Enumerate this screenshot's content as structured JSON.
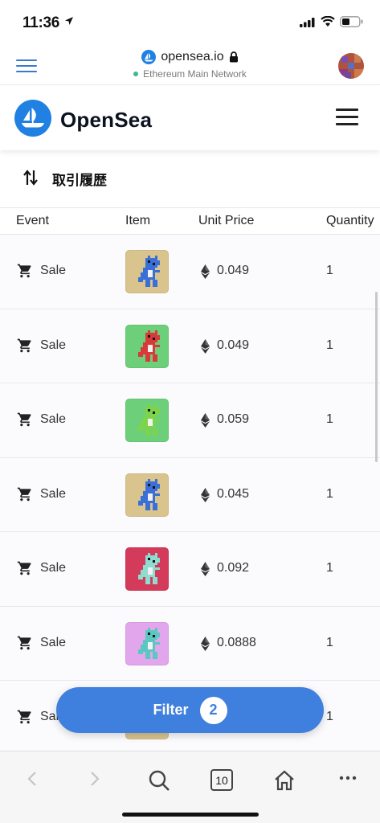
{
  "status_bar": {
    "time": "11:36"
  },
  "wallet_browser": {
    "url": "opensea.io",
    "network": "Ethereum Main Network"
  },
  "site_nav": {
    "brand": "OpenSea"
  },
  "activity": {
    "title": "取引履歴",
    "columns": {
      "event": "Event",
      "item": "Item",
      "unit_price": "Unit Price",
      "quantity": "Quantity"
    },
    "rows": [
      {
        "event": "Sale",
        "price": "0.049",
        "quantity": "1",
        "thumb_bg": "#d9c48e",
        "dino_color": "#3a6fd8"
      },
      {
        "event": "Sale",
        "price": "0.049",
        "quantity": "1",
        "thumb_bg": "#6ecf7a",
        "dino_color": "#d83a3a"
      },
      {
        "event": "Sale",
        "price": "0.059",
        "quantity": "1",
        "thumb_bg": "#6ecf7a",
        "dino_color": "#7bd44a"
      },
      {
        "event": "Sale",
        "price": "0.045",
        "quantity": "1",
        "thumb_bg": "#d9c48e",
        "dino_color": "#3a6fd8"
      },
      {
        "event": "Sale",
        "price": "0.092",
        "quantity": "1",
        "thumb_bg": "#d43a5a",
        "dino_color": "#8fdcd0"
      },
      {
        "event": "Sale",
        "price": "0.0888",
        "quantity": "1",
        "thumb_bg": "#e2a6ec",
        "dino_color": "#5ac8c0"
      },
      {
        "event": "Sale",
        "price": "",
        "quantity": "1",
        "thumb_bg": "#d9c48e",
        "dino_color": "#3a6fd8"
      }
    ]
  },
  "filter": {
    "label": "Filter",
    "count": "2"
  },
  "toolbar": {
    "tab_count": "10"
  },
  "colors": {
    "accent": "#3f7fde",
    "opensea_blue": "#2081e2"
  },
  "icons": {
    "activity": "swap-vertical-icon",
    "event": "cart-icon",
    "price": "ethereum-icon"
  }
}
